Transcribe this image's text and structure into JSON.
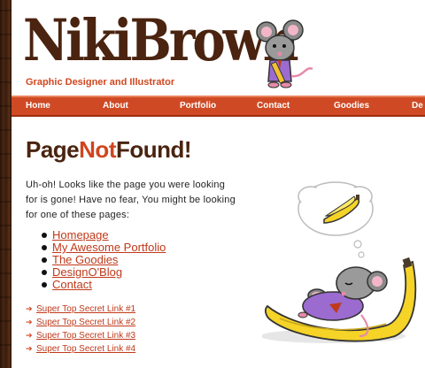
{
  "logo": {
    "name": "NikiBrown",
    "tagline": "Graphic Designer and Illustrator"
  },
  "nav": {
    "items": [
      "Home",
      "About",
      "Portfolio",
      "Contact",
      "Goodies",
      "De"
    ]
  },
  "page": {
    "title_part1": "Page",
    "title_part2": "Not",
    "title_part3": "Found!",
    "intro": "Uh-oh! Looks like the page you were looking for is gone! Have no fear, You might be looking for one of these pages:"
  },
  "pages": [
    "Homepage",
    "My Awesome Portfolio",
    "The Goodies",
    "DesignO'Blog",
    "Contact"
  ],
  "secret_links": [
    "Super Top Secret Link #1",
    "Super Top Secret Link #2",
    "Super Top Secret Link #3",
    "Super Top Secret Link #4"
  ],
  "icons": {
    "logo_mascot": "mouse-with-pencil-icon",
    "illustration": "mouse-sleeping-on-banana-icon",
    "thought": "banana-thought-bubble-icon",
    "link_arrow": "arrow-right-icon"
  },
  "colors": {
    "brand_brown": "#4a2410",
    "accent_orange": "#d0461f",
    "nav_bg": "#cf4a24",
    "link": "#c0391a"
  }
}
